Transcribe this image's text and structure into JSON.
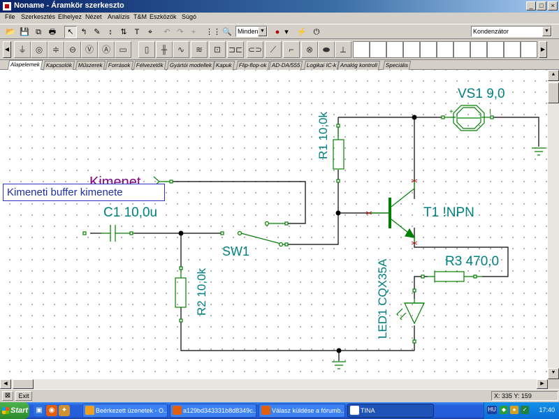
{
  "window": {
    "title": "Noname - Áramkör szerkeszto",
    "minimize": "_",
    "maximize": "□",
    "close": "×"
  },
  "menu": [
    "File",
    "Szerkesztés",
    "Elhelyez",
    "Nézet",
    "Analízis",
    "T&M",
    "Eszközök",
    "Súgó"
  ],
  "toolbar": {
    "layer_filter": "Minden",
    "component_select": "Kondenzátor"
  },
  "tabs": [
    "Alapelemek",
    "Kapcsolók",
    "Műszerek",
    "Források",
    "Félvezetők",
    "Gyártói modellek",
    "Kapuk",
    "Flip-flop-ok",
    "AD-DA/555",
    "Logikai IC-k",
    "Analóg kontroll",
    "Speciális"
  ],
  "schematic": {
    "labels": {
      "vs1": "VS1 9,0",
      "r1": "R1 10,0k",
      "kimenet": "Kimenet",
      "c1": "C1 10,0u",
      "t1": "T1 !NPN",
      "sw1": "SW1",
      "r3": "R3 470,0",
      "r2": "R2 10,0k",
      "led1": "LED1 CQX35A",
      "buffer": "Kimeneti buffer kimenete",
      "vs_plus": "+",
      "vs_minus": "I"
    },
    "colors": {
      "wire": "#000000",
      "component": "#008000",
      "label": "#008080",
      "output_label": "#800080",
      "text_box": "#2030a0"
    }
  },
  "status": {
    "exit": "Exit",
    "coords": "X: 335  Y: 159"
  },
  "taskbar": {
    "start": "Start",
    "tasks": [
      "Beérkezett üzenetek - O...",
      "a129bd343331b8d8349c...",
      "Válasz küldése a fórumb...",
      "TINA"
    ],
    "clock": "17:40",
    "tray_lang": "HU"
  }
}
